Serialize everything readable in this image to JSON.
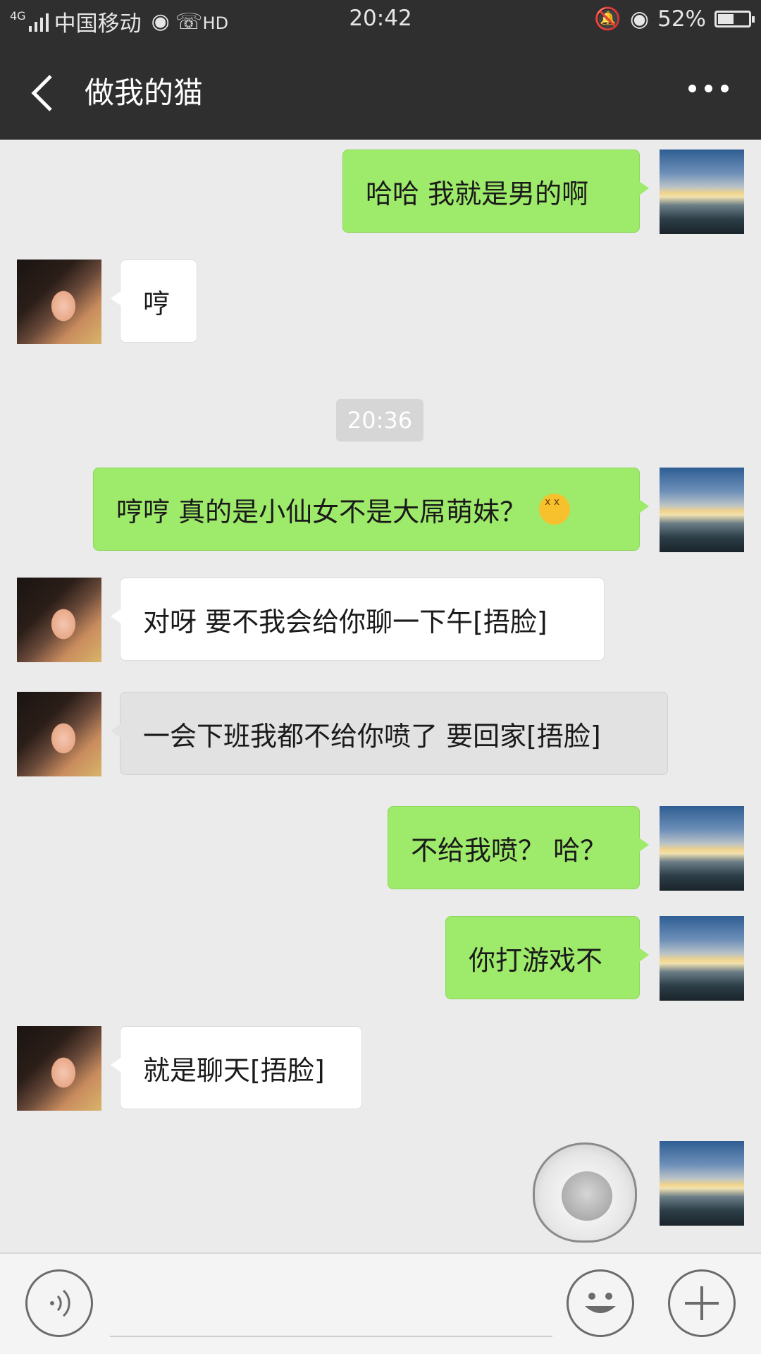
{
  "status_bar": {
    "signal_label": "4G",
    "carrier": "中国移动",
    "wifi_icon": "wifi-icon",
    "hd_label": "HD",
    "time": "20:42",
    "battery": "52%"
  },
  "header": {
    "back_icon": "chevron-left-icon",
    "title": "做我的猫",
    "more_icon": "more-dots-icon"
  },
  "messages": [
    {
      "from": "me",
      "text": "哈哈  我就是男的啊"
    },
    {
      "from": "other",
      "text": "哼"
    },
    {
      "from": "me",
      "text": "哼哼 真的是小仙女不是大屌萌妹？",
      "emoji": "grinning-squint-emoji"
    },
    {
      "from": "other",
      "text": "对呀 要不我会给你聊一下午[捂脸]"
    },
    {
      "from": "other",
      "text": "一会下班我都不给你喷了 要回家[捂脸]"
    },
    {
      "from": "me",
      "text": "不给我喷？  哈？"
    },
    {
      "from": "me",
      "text": "你打游戏不"
    },
    {
      "from": "other",
      "text": "就是聊天[捂脸]"
    },
    {
      "from": "me",
      "sticker": "cat-meme-sticker"
    }
  ],
  "timestamp": "20:36",
  "input_bar": {
    "voice_icon": "voice-icon",
    "input_value": "",
    "emoji_icon": "emoji-icon",
    "plus_icon": "plus-icon"
  },
  "colors": {
    "bar": "#2f2f2f",
    "chat_bg": "#ebebeb",
    "outgoing_bubble": "#9eea6a",
    "incoming_bubble": "#ffffff"
  }
}
